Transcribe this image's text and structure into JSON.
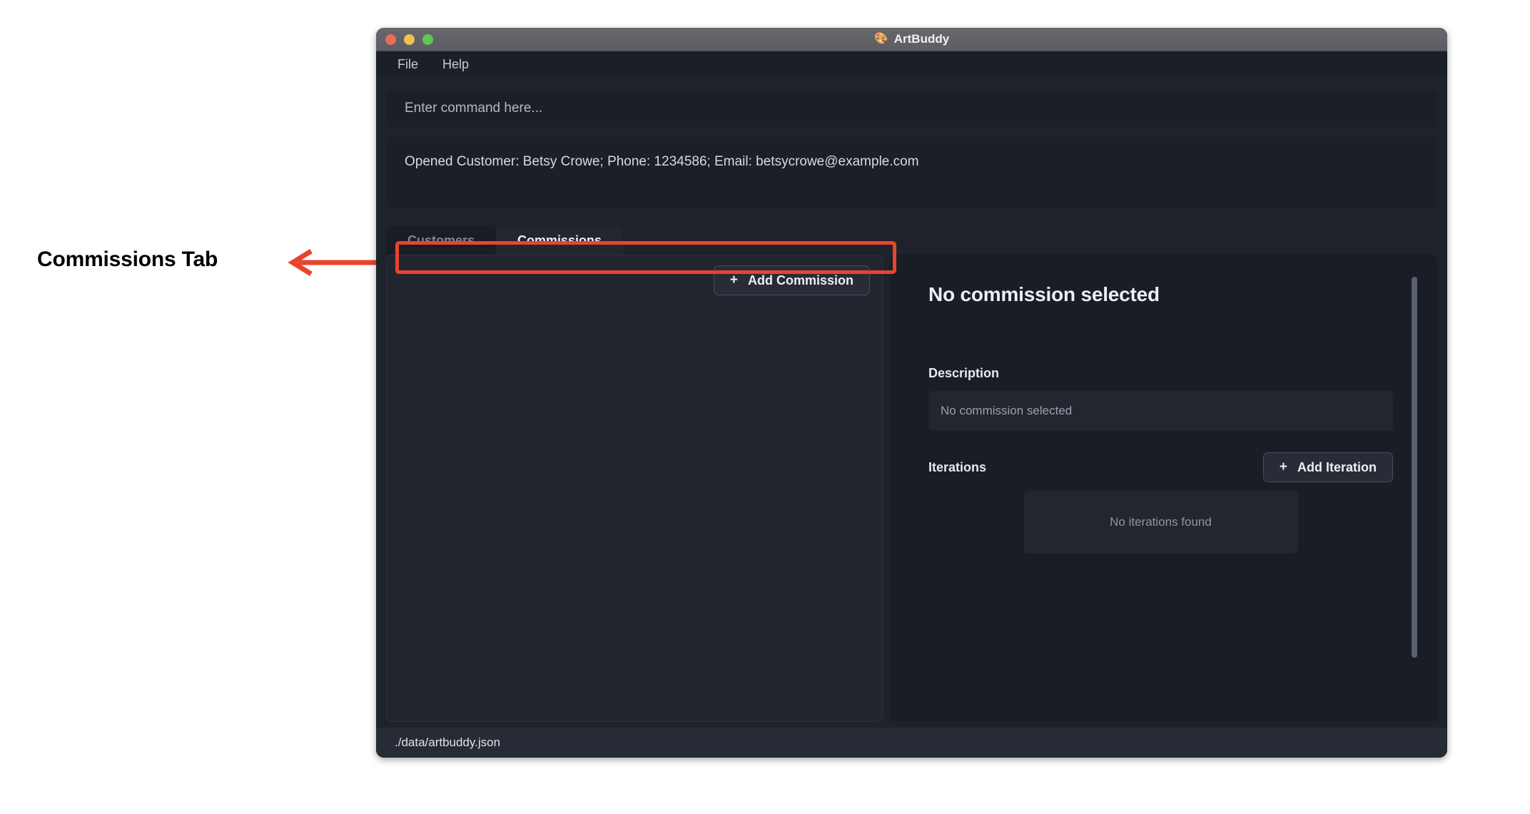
{
  "annotation": {
    "label": "Commissions Tab",
    "arrow_icon": "left-arrow-icon",
    "highlight_color": "#e8452c"
  },
  "window": {
    "title": "ArtBuddy",
    "app_icon": "palette-icon",
    "traffic_lights": {
      "close": "close-window-button",
      "minimize": "minimize-window-button",
      "maximize": "maximize-window-button"
    }
  },
  "menubar": {
    "items": [
      {
        "label": "File"
      },
      {
        "label": "Help"
      }
    ]
  },
  "command": {
    "placeholder": "Enter command here...",
    "value": ""
  },
  "status_panel": {
    "message": "Opened Customer: Betsy Crowe; Phone: 1234586; Email: betsycrowe@example.com"
  },
  "tabs": [
    {
      "label": "Customers",
      "active": false
    },
    {
      "label": "Commissions",
      "active": true
    }
  ],
  "list_panel": {
    "add_button": {
      "plus": "+",
      "label": "Add Commission"
    },
    "items": []
  },
  "detail_panel": {
    "title": "No commission selected",
    "description": {
      "label": "Description",
      "value": "",
      "placeholder": "No commission selected"
    },
    "iterations": {
      "label": "Iterations",
      "add_button": {
        "plus": "+",
        "label": "Add Iteration"
      },
      "empty_text": "No iterations found",
      "items": []
    }
  },
  "statusbar": {
    "file_path": "./data/artbuddy.json"
  }
}
